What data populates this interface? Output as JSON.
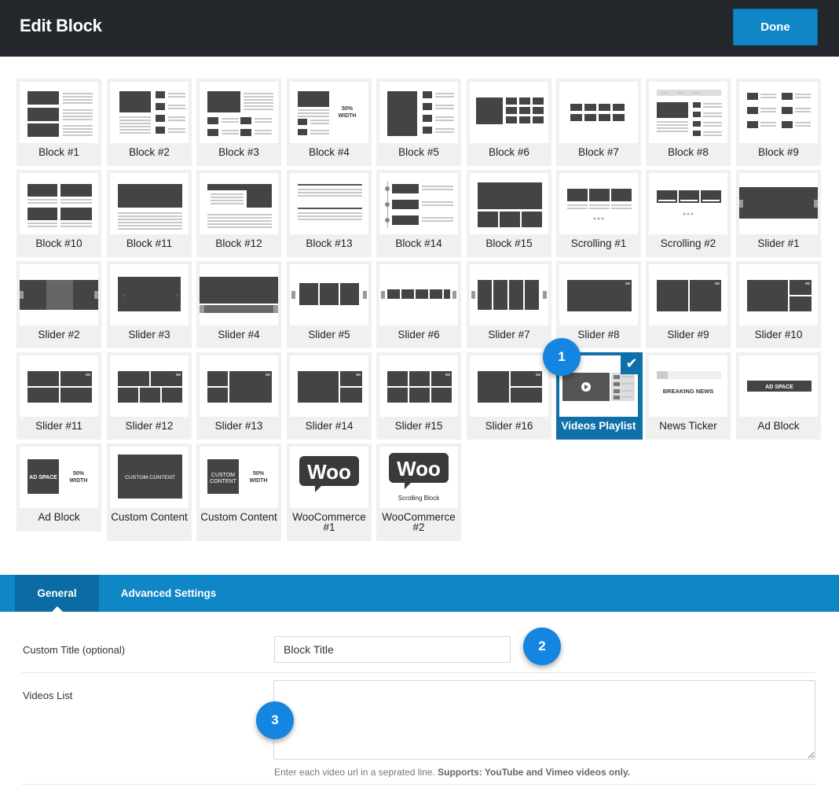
{
  "header": {
    "title": "Edit Block",
    "done_label": "Done"
  },
  "blocks": [
    {
      "label": "Block #1",
      "thumb": "b1"
    },
    {
      "label": "Block #2",
      "thumb": "b2"
    },
    {
      "label": "Block #3",
      "thumb": "b3"
    },
    {
      "label": "Block #4",
      "thumb": "b4"
    },
    {
      "label": "Block #5",
      "thumb": "b5"
    },
    {
      "label": "Block #6",
      "thumb": "b6"
    },
    {
      "label": "Block #7",
      "thumb": "b7"
    },
    {
      "label": "Block #8",
      "thumb": "b8"
    },
    {
      "label": "Block #9",
      "thumb": "b9"
    },
    {
      "label": "Block #10",
      "thumb": "b10"
    },
    {
      "label": "Block #11",
      "thumb": "b11"
    },
    {
      "label": "Block #12",
      "thumb": "b12"
    },
    {
      "label": "Block #13",
      "thumb": "b13"
    },
    {
      "label": "Block #14",
      "thumb": "b14"
    },
    {
      "label": "Block #15",
      "thumb": "b15"
    },
    {
      "label": "Scrolling #1",
      "thumb": "sc1"
    },
    {
      "label": "Scrolling #2",
      "thumb": "sc2"
    },
    {
      "label": "Slider #1",
      "thumb": "s1"
    },
    {
      "label": "Slider #2",
      "thumb": "s2"
    },
    {
      "label": "Slider #3",
      "thumb": "s3"
    },
    {
      "label": "Slider #4",
      "thumb": "s4"
    },
    {
      "label": "Slider #5",
      "thumb": "s5"
    },
    {
      "label": "Slider #6",
      "thumb": "s6"
    },
    {
      "label": "Slider #7",
      "thumb": "s7"
    },
    {
      "label": "Slider #8",
      "thumb": "s8"
    },
    {
      "label": "Slider #9",
      "thumb": "s9"
    },
    {
      "label": "Slider #10",
      "thumb": "s10"
    },
    {
      "label": "Slider #11",
      "thumb": "s11"
    },
    {
      "label": "Slider #12",
      "thumb": "s12"
    },
    {
      "label": "Slider #13",
      "thumb": "s13"
    },
    {
      "label": "Slider #14",
      "thumb": "s14"
    },
    {
      "label": "Slider #15",
      "thumb": "s15"
    },
    {
      "label": "Slider #16",
      "thumb": "s16"
    },
    {
      "label": "Videos Playlist",
      "thumb": "vp",
      "selected": true
    },
    {
      "label": "News Ticker",
      "thumb": "nt"
    },
    {
      "label": "Ad Block",
      "thumb": "ad1"
    },
    {
      "label": "Ad Block",
      "thumb": "ad2"
    },
    {
      "label": "Custom Content",
      "thumb": "cc1"
    },
    {
      "label": "Custom Content",
      "thumb": "cc2"
    },
    {
      "label": "WooCommerce #1",
      "thumb": "woo1"
    },
    {
      "label": "WooCommerce #2",
      "thumb": "woo2"
    }
  ],
  "thumb_text": {
    "half_width_a": "50%",
    "half_width_b": "WIDTH",
    "breaking_news": "BREAKING NEWS",
    "ad_space": "AD SPACE",
    "custom_content": "CUSTOM CONTENT",
    "custom_content_a": "CUSTOM",
    "custom_content_b": "CONTENT",
    "woo": "Woo",
    "scrolling_block": "Scrolling Block"
  },
  "selected_check": "✔",
  "markers": [
    "1",
    "2",
    "3"
  ],
  "tabs": [
    {
      "label": "General",
      "active": true
    },
    {
      "label": "Advanced Settings",
      "active": false
    }
  ],
  "form": {
    "custom_title_label": "Custom Title (optional)",
    "custom_title_value": "Block Title",
    "videos_list_label": "Videos List",
    "videos_list_value": "",
    "help_text": "Enter each video url in a seprated line.",
    "help_strong": "Supports: YouTube and Vimeo videos only."
  },
  "colors": {
    "header_bg": "#24272c",
    "accent": "#0f87c7",
    "selected": "#0f6fa8",
    "marker": "#1485e0"
  }
}
